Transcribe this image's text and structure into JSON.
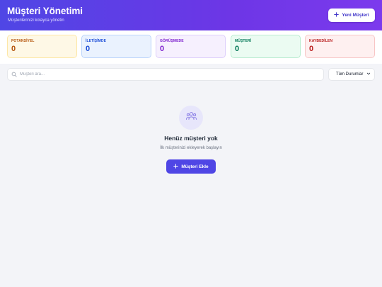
{
  "header": {
    "title": "Müşteri Yönetimi",
    "subtitle": "Müşterilerinizi kolayca yönetin",
    "new_button_label": "Yeni Müşteri"
  },
  "stats": [
    {
      "label": "POTANSİYEL",
      "value": "0"
    },
    {
      "label": "İLETİŞİMDE",
      "value": "0"
    },
    {
      "label": "GÖRÜŞMEDE",
      "value": "0"
    },
    {
      "label": "MÜŞTERİ",
      "value": "0"
    },
    {
      "label": "KAYBEDİLEN",
      "value": "0"
    }
  ],
  "filters": {
    "search_placeholder": "Müşteri ara...",
    "search_value": "",
    "status_selected": "Tüm Durumlar"
  },
  "empty_state": {
    "title": "Henüz müşteri yok",
    "description": "İlk müşterinizi ekleyerek başlayın",
    "button_label": "Müşteri Ekle"
  },
  "icons": {
    "plus": "plus-icon",
    "search": "search-icon",
    "chevron": "chevron-down-icon",
    "users": "users-icon"
  },
  "colors": {
    "accent": "#4f46e5",
    "header_gradient_start": "#4f46e5",
    "header_gradient_end": "#7c3aed"
  }
}
